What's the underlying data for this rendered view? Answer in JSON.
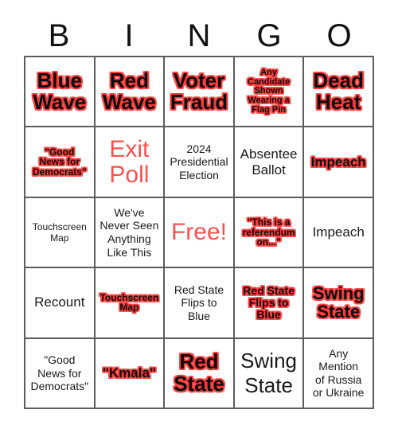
{
  "card": {
    "header_letters": [
      "B",
      "I",
      "N",
      "G",
      "O"
    ],
    "columns": 5,
    "rows": 5,
    "colors": {
      "outline_red": "#fb3b3b",
      "solid_red": "#fa5250",
      "text_black": "#1a1a1a",
      "grid_border": "#5d5d5d",
      "background": "#ffffff"
    },
    "cells": [
      {
        "text": "Blue\nWave",
        "style": "outline",
        "size": "xl"
      },
      {
        "text": "Red\nWave",
        "style": "outline",
        "size": "xl"
      },
      {
        "text": "Voter\nFraud",
        "style": "outline",
        "size": "xl"
      },
      {
        "text": "Any\nCandidate\nShown\nWearing a\nFlag Pin",
        "style": "outline",
        "size": "xxs"
      },
      {
        "text": "Dead\nHeat",
        "style": "outline",
        "size": "xl"
      },
      {
        "text": "\"Good\nNews for\nDemocrats\"",
        "style": "outline",
        "size": "xs"
      },
      {
        "text": "Exit\nPoll",
        "style": "solidred",
        "size": "xxl"
      },
      {
        "text": "2024\nPresidential\nElection",
        "style": "plain",
        "size": "sm"
      },
      {
        "text": "Absentee\nBallot",
        "style": "plain",
        "size": "md"
      },
      {
        "text": "Impeach",
        "style": "outline",
        "size": "md"
      },
      {
        "text": "Touchscreen\nMap",
        "style": "plain",
        "size": "xs"
      },
      {
        "text": "We've\nNever Seen\nAnything\nLike This",
        "style": "plain",
        "size": "sm"
      },
      {
        "text": "Free!",
        "style": "solidred",
        "size": "xxl"
      },
      {
        "text": "\"This is a\nreferendum\non...\"",
        "style": "outline",
        "size": "xs"
      },
      {
        "text": "Impeach",
        "style": "plain",
        "size": "md"
      },
      {
        "text": "Recount",
        "style": "plain",
        "size": "md"
      },
      {
        "text": "Touchscreen\nMap",
        "style": "outline",
        "size": "xs"
      },
      {
        "text": "Red State\nFlips to\nBlue",
        "style": "plain",
        "size": "sm"
      },
      {
        "text": "Red State\nFlips to\nBlue",
        "style": "outline",
        "size": "sm"
      },
      {
        "text": "Swing\nState",
        "style": "outline",
        "size": "lg"
      },
      {
        "text": "\"Good\nNews for\nDemocrats\"",
        "style": "plain",
        "size": "sm"
      },
      {
        "text": "\"Kmala\"",
        "style": "outline",
        "size": "md"
      },
      {
        "text": "Red\nState",
        "style": "outline",
        "size": "xl"
      },
      {
        "text": "Swing\nState",
        "style": "plain",
        "size": "xl"
      },
      {
        "text": "Any\nMention\nof Russia\nor Ukraine",
        "style": "plain",
        "size": "sm"
      }
    ]
  }
}
